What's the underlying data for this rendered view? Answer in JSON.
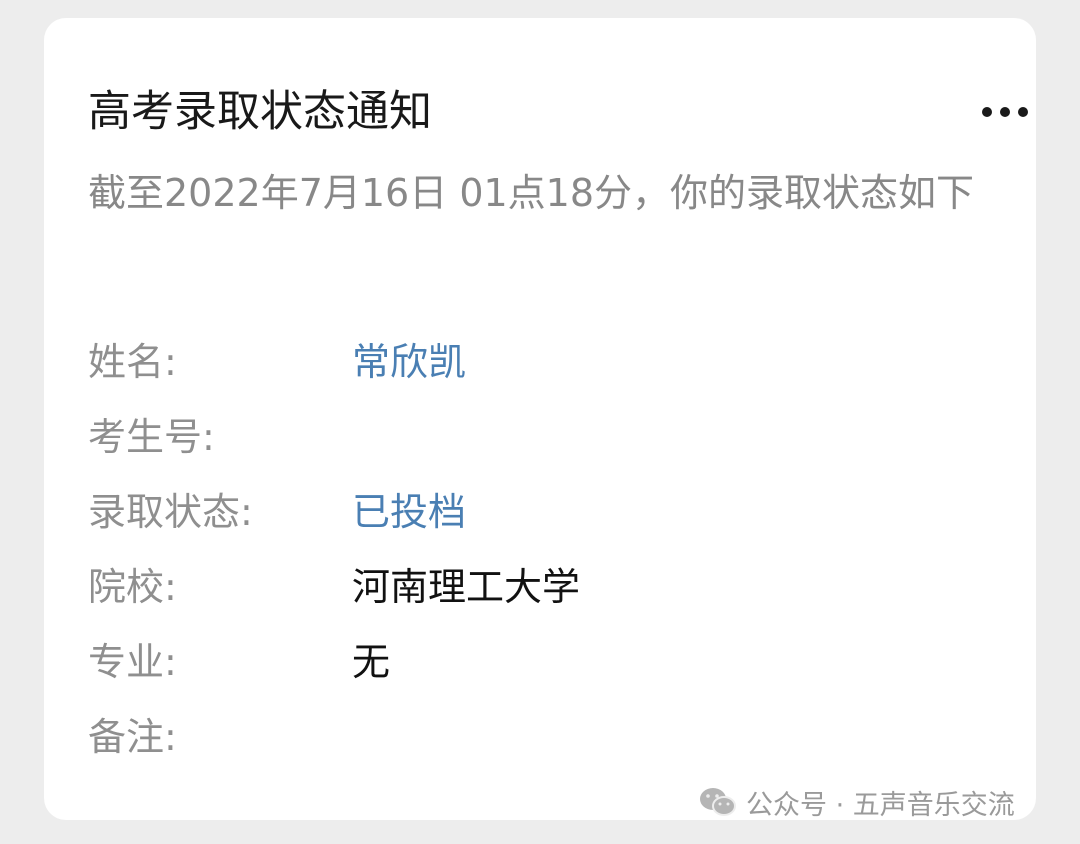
{
  "card": {
    "title": "高考录取状态通知",
    "subtitle": "截至2022年7月16日 01点18分，你的录取状态如下"
  },
  "fields": {
    "name": {
      "label": "姓名:",
      "value": "常欣凯"
    },
    "exam_number": {
      "label": "考生号:",
      "value": ""
    },
    "admission_status": {
      "label": "录取状态:",
      "value": "已投档"
    },
    "school": {
      "label": "院校:",
      "value": "河南理工大学"
    },
    "major": {
      "label": "专业:",
      "value": "无"
    },
    "remarks": {
      "label": "备注:",
      "value": ""
    }
  },
  "watermark": {
    "text": "公众号 · 五声音乐交流",
    "icon": "wechat-icon"
  },
  "colors": {
    "link_value": "#4a7fb3",
    "label": "#8f8f8f",
    "title": "#191919",
    "background": "#ededed"
  }
}
